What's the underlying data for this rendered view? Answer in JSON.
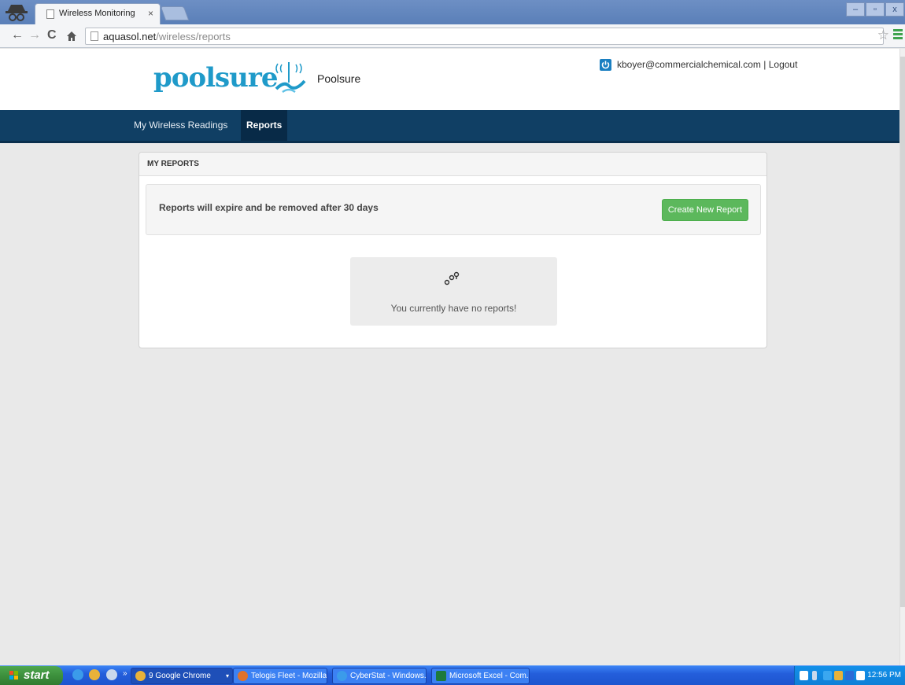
{
  "browser": {
    "tab_title": "Wireless Monitoring",
    "tab_close": "×",
    "url_host": "aquasol.net",
    "url_path": "/wireless/reports",
    "window_buttons": [
      "–",
      "▫",
      "x"
    ]
  },
  "header": {
    "logo_text": "poolsure",
    "brand_name": "Poolsure",
    "user_email": "kboyer@commercialchemical.com",
    "separator": "|",
    "logout_label": "Logout"
  },
  "nav": {
    "items": [
      {
        "label": "My Wireless Readings"
      },
      {
        "label": "Reports"
      }
    ]
  },
  "reports": {
    "panel_title": "MY REPORTS",
    "notice": "Reports will expire and be removed after 30 days",
    "create_button": "Create New Report",
    "empty_message": "You currently have no reports!"
  },
  "taskbar": {
    "start_label": "start",
    "quicklaunch_more": "»",
    "tasks": [
      {
        "label": "9 Google Chrome"
      },
      {
        "label": "Telogis Fleet - Mozilla ..."
      },
      {
        "label": "CyberStat - Windows..."
      },
      {
        "label": "Microsoft Excel - Com..."
      }
    ],
    "clock": "12:56 PM"
  },
  "colors": {
    "nav_bg": "#103f64",
    "brand_blue": "#1f9ac9",
    "button_green": "#5cb85c",
    "taskbar_blue": "#245edb"
  }
}
